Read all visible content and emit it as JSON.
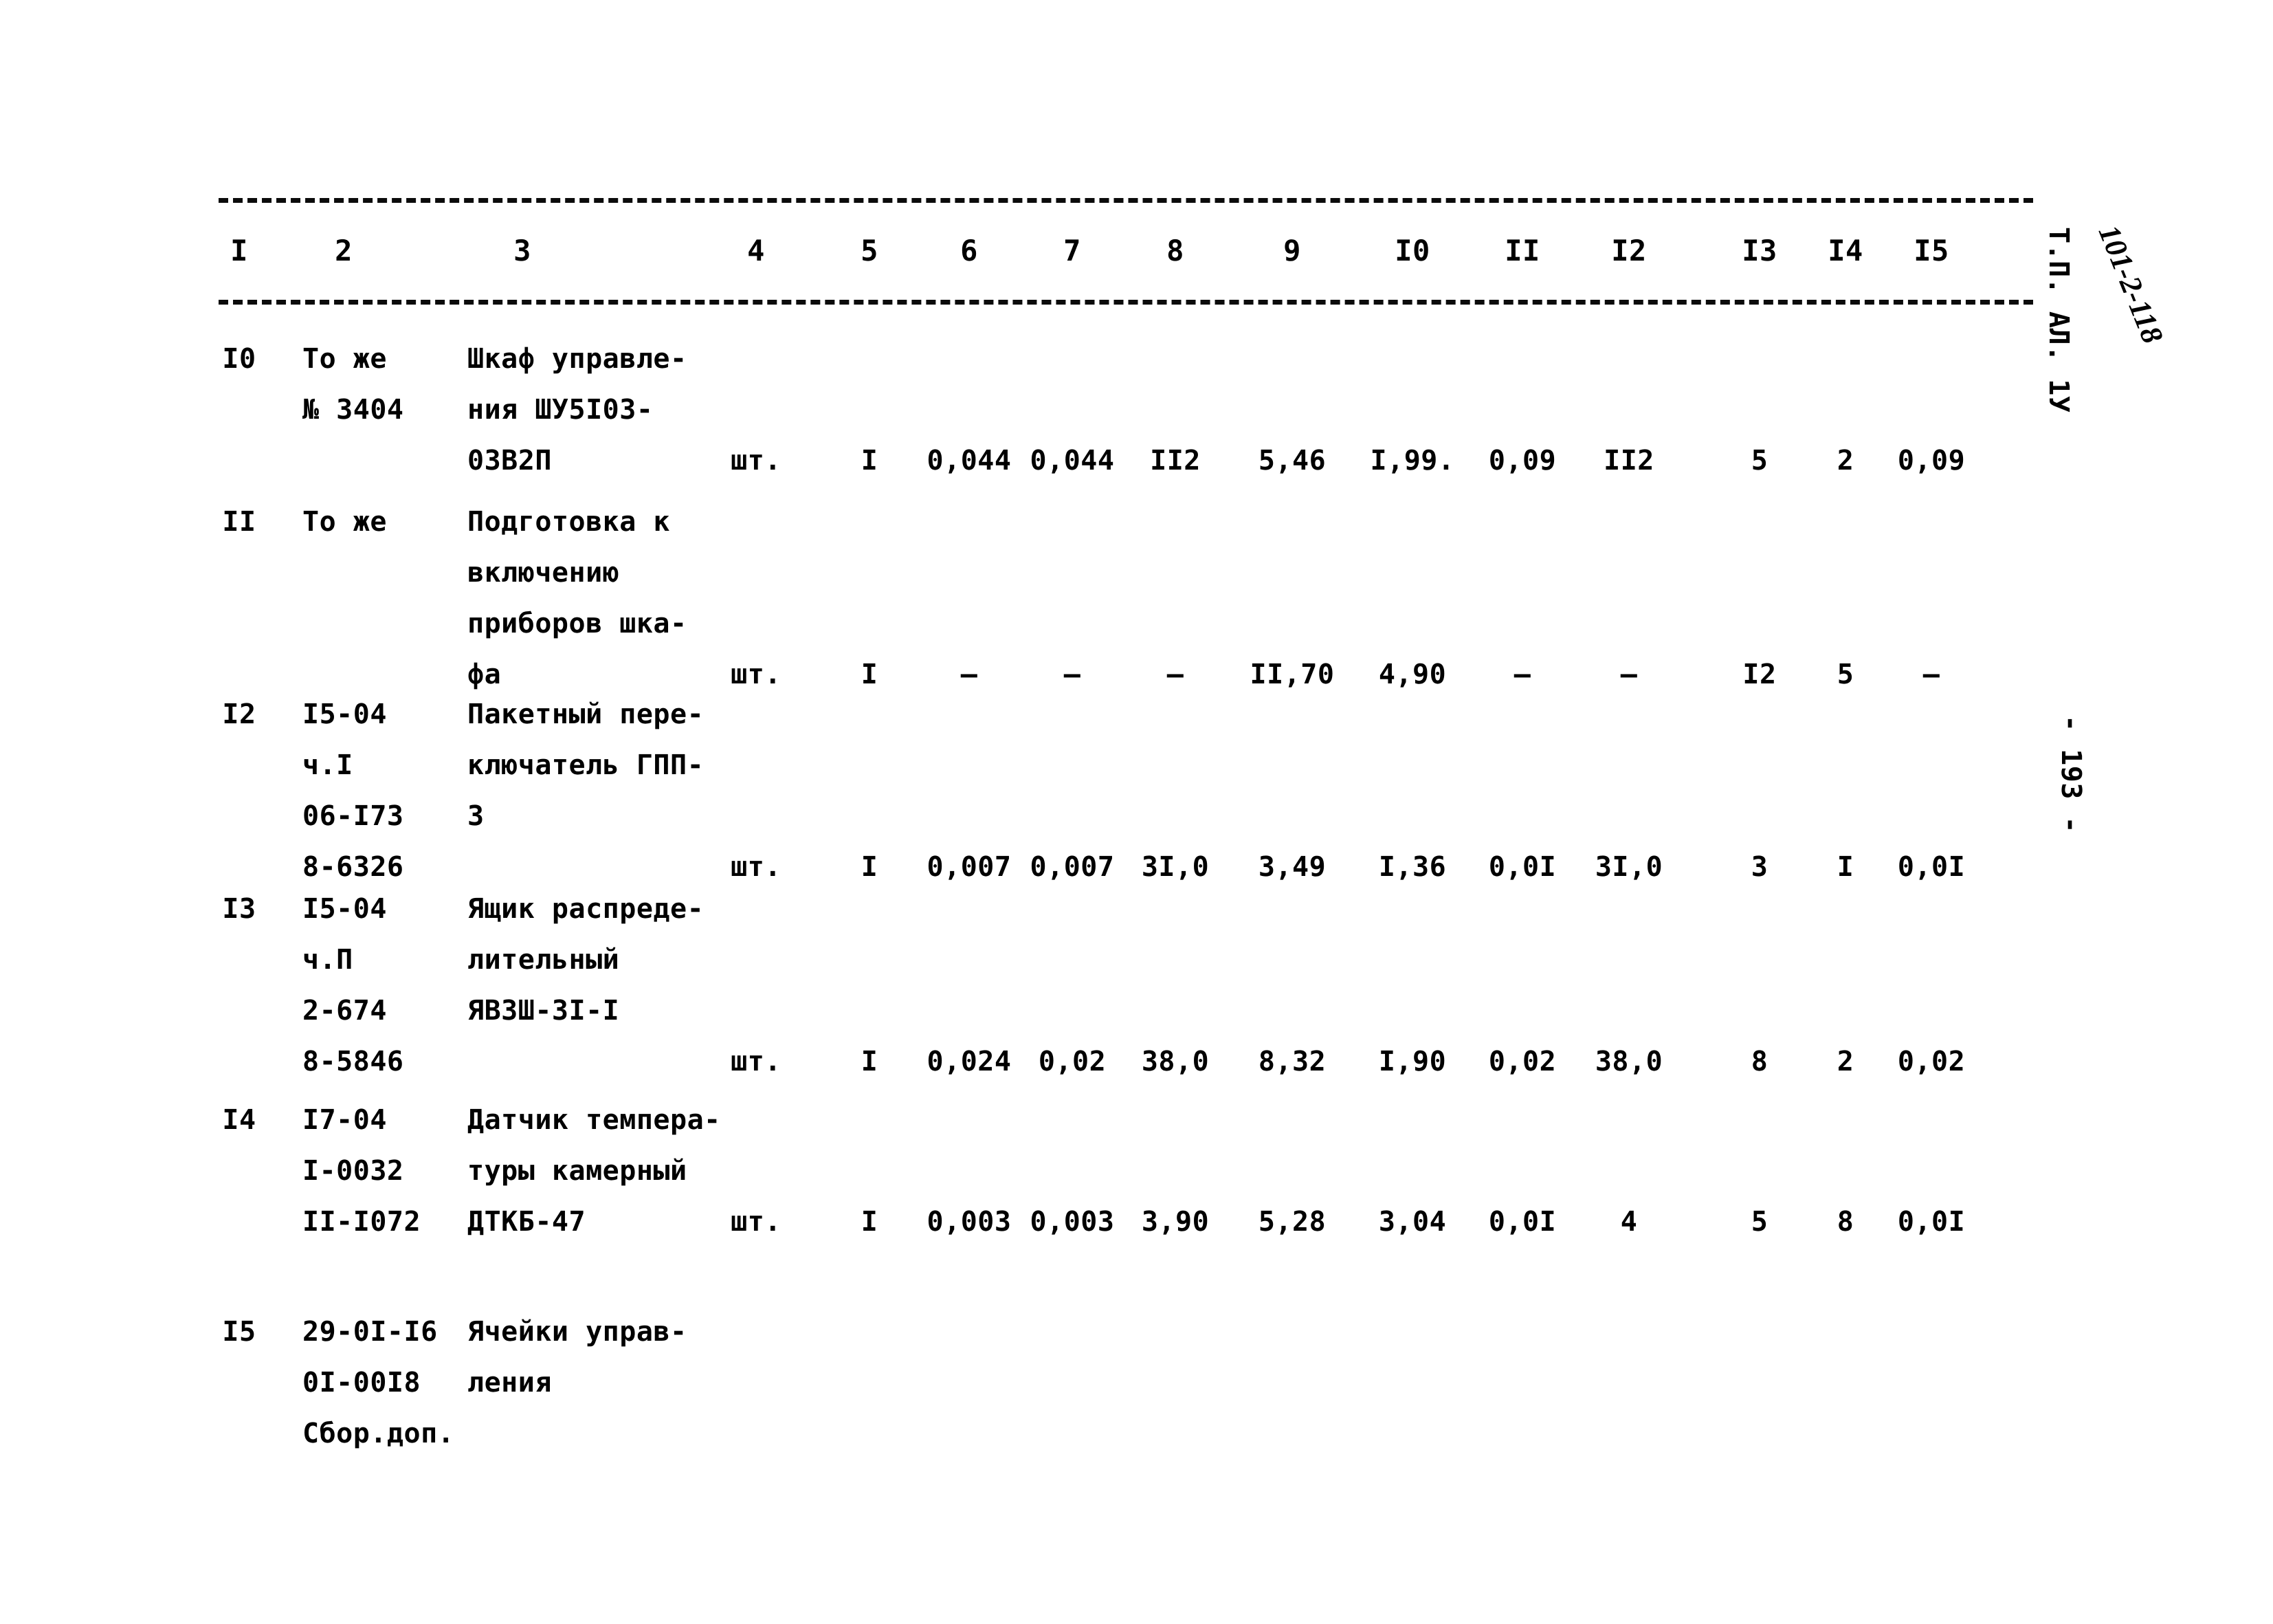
{
  "document": {
    "kind": "scan",
    "page_number_label": "- 193 -",
    "margin_typed_label": "Т.П. АЛ. 1У",
    "margin_handwritten_label": "101-2-118",
    "ink_color": "#0a0a0a",
    "paper_color": "#ffffff"
  },
  "table": {
    "column_headers": [
      "I",
      "2",
      "3",
      "4",
      "5",
      "6",
      "7",
      "8",
      "9",
      "I0",
      "II",
      "I2",
      "I3",
      "I4",
      "I5"
    ],
    "rows": [
      {
        "no": "I0",
        "code_lines": [
          "То же",
          "№ 3404"
        ],
        "name_lines": [
          "Шкаф управле-",
          "ния ШУ5I03-",
          "03В2П"
        ],
        "unit": "шт.",
        "values": [
          "I",
          "0,044",
          "0,044",
          "II2",
          "5,46",
          "I,99.",
          "0,09",
          "II2",
          "5",
          "2",
          "0,09"
        ]
      },
      {
        "no": "II",
        "code_lines": [
          "То же"
        ],
        "name_lines": [
          "Подготовка к",
          "включению",
          "приборов шка-",
          "фа"
        ],
        "unit": "шт.",
        "values": [
          "I",
          "–",
          "–",
          "–",
          "II,70",
          "4,90",
          "–",
          "–",
          "I2",
          "5",
          "–"
        ]
      },
      {
        "no": "I2",
        "code_lines": [
          "I5-04",
          "ч.I",
          "06-I73",
          "8-6326"
        ],
        "name_lines": [
          "Пакетный пере-",
          "ключатель ГПП-",
          "3"
        ],
        "unit": "шт.",
        "values": [
          "I",
          "0,007",
          "0,007",
          "3I,0",
          "3,49",
          "I,36",
          "0,0I",
          "3I,0",
          "3",
          "I",
          "0,0I"
        ]
      },
      {
        "no": "I3",
        "code_lines": [
          "I5-04",
          "ч.П",
          "2-674",
          "8-5846"
        ],
        "name_lines": [
          "Ящик распреде-",
          "лительный",
          "ЯВЗШ-3I-I"
        ],
        "unit": "шт.",
        "values": [
          "I",
          "0,024",
          "0,02",
          "38,0",
          "8,32",
          "I,90",
          "0,02",
          "38,0",
          "8",
          "2",
          "0,02"
        ]
      },
      {
        "no": "I4",
        "code_lines": [
          "I7-04",
          "I-0032",
          "II-I072"
        ],
        "name_lines": [
          "Датчик темпера-",
          "туры камерный",
          "ДТКБ-47"
        ],
        "unit": "шт.",
        "values": [
          "I",
          "0,003",
          "0,003",
          "3,90",
          "5,28",
          "3,04",
          "0,0I",
          "4",
          "5",
          "8",
          "0,0I"
        ]
      },
      {
        "no": "I5",
        "code_lines": [
          "29-0I-I6",
          "0I-00I8",
          "Сбор.доп."
        ],
        "name_lines": [
          "Ячейки управ-",
          "ления"
        ],
        "unit": "",
        "values": [
          "",
          "",
          "",
          "",
          "",
          "",
          "",
          "",
          "",
          "",
          ""
        ]
      }
    ]
  }
}
